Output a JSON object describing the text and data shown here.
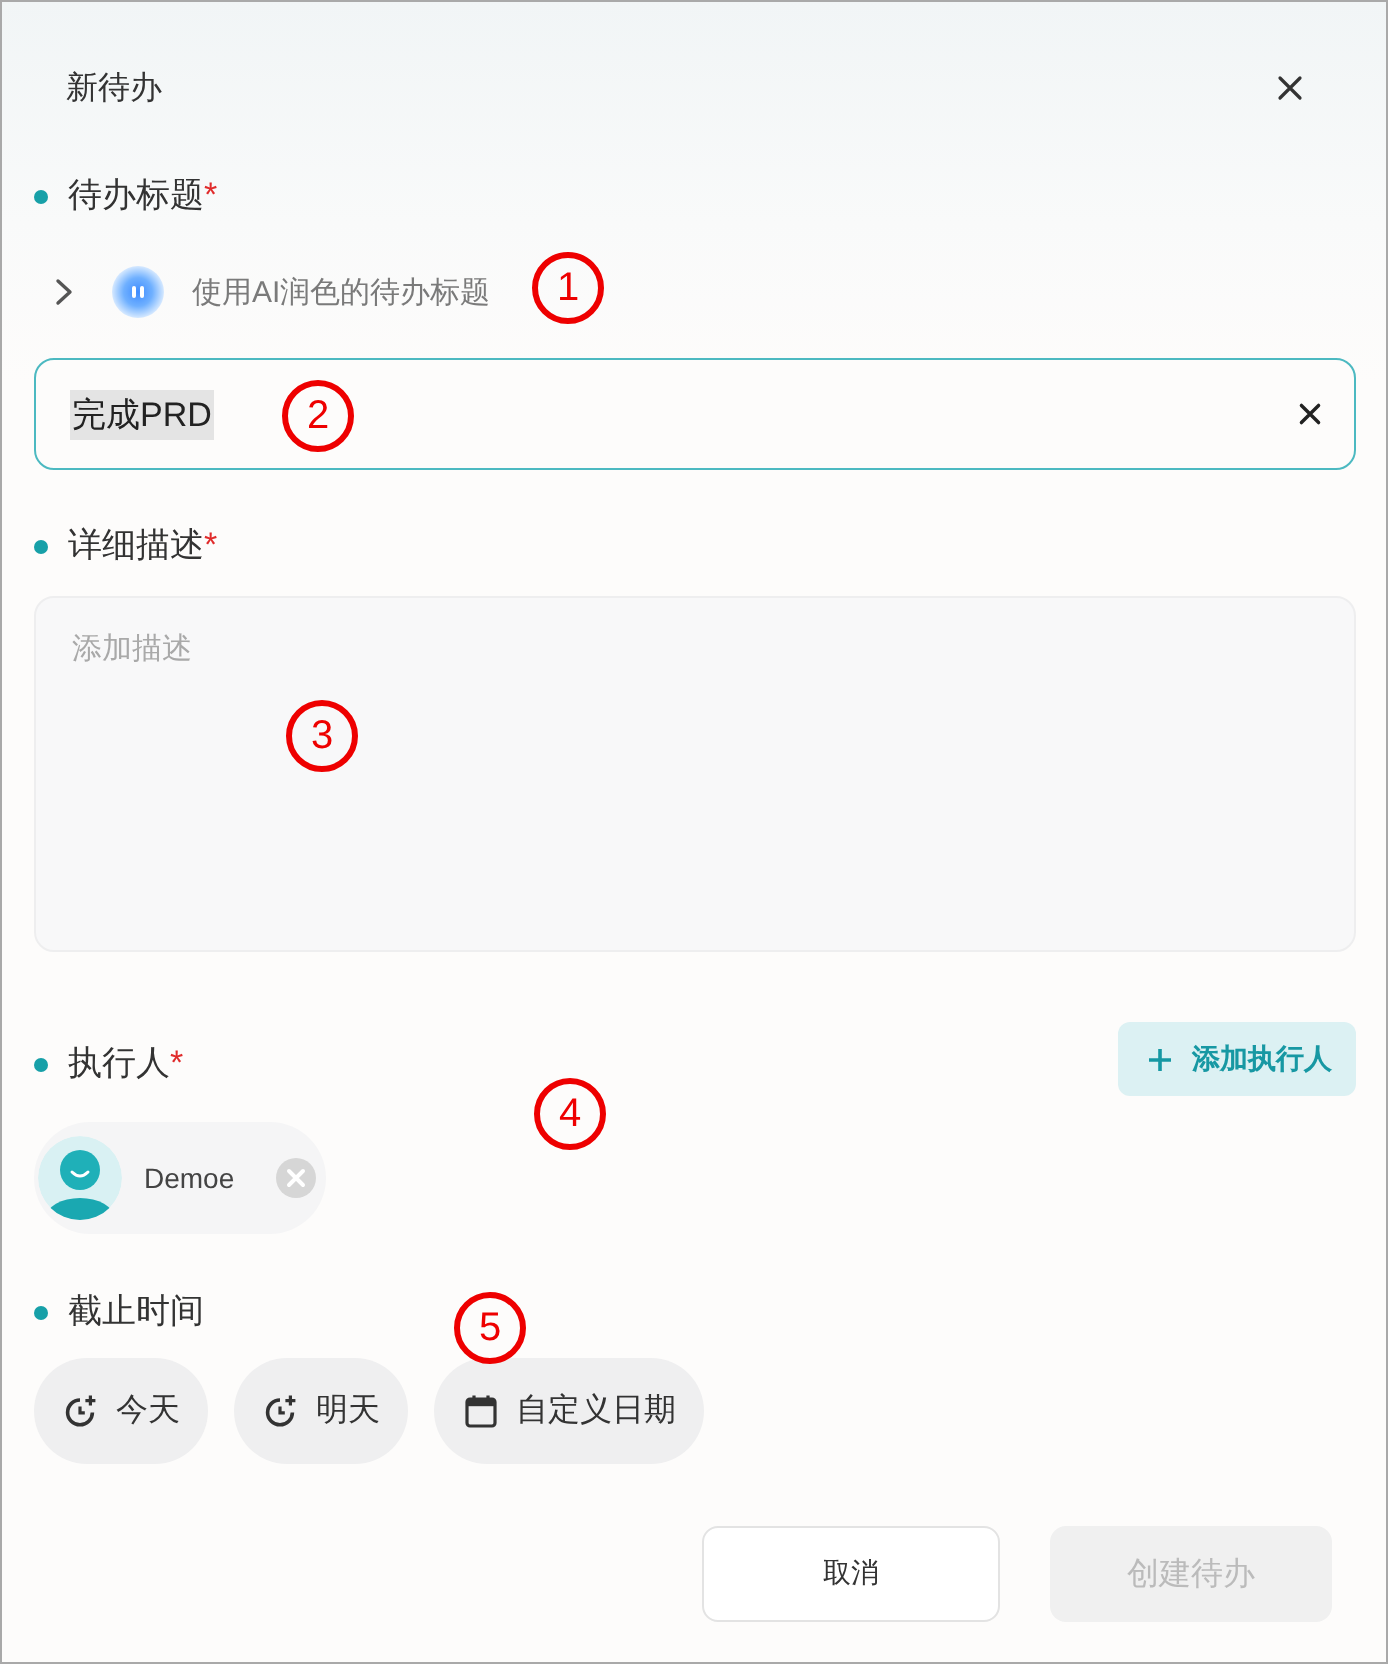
{
  "dialog": {
    "title": "新待办"
  },
  "title_section": {
    "label": "待办标题",
    "required_mark": "*",
    "ai_suggestion": {
      "text": "使用AI润色的待办标题",
      "expanded": false
    },
    "input": {
      "value": "完成PRD",
      "highlighted": true
    }
  },
  "description_section": {
    "label": "详细描述",
    "required_mark": "*",
    "textarea": {
      "placeholder": "添加描述"
    }
  },
  "assignee_section": {
    "label": "执行人",
    "required_mark": "*",
    "add_button": {
      "label": "添加执行人"
    },
    "assignees": [
      {
        "name": "Demoe"
      }
    ]
  },
  "deadline_section": {
    "label": "截止时间",
    "options": [
      {
        "label": "今天",
        "kind": "today",
        "selected": false
      },
      {
        "label": "明天",
        "kind": "tomorrow",
        "selected": false
      },
      {
        "label": "自定义日期",
        "kind": "custom",
        "selected": false
      }
    ]
  },
  "footer": {
    "buttons": [
      {
        "label": "取消",
        "kind": "secondary",
        "disabled": false
      },
      {
        "label": "创建待办",
        "kind": "primary",
        "disabled": true
      }
    ]
  },
  "annotations": [
    {
      "label": "1"
    },
    {
      "label": "2"
    },
    {
      "label": "3"
    },
    {
      "label": "4"
    },
    {
      "label": "5"
    }
  ]
}
